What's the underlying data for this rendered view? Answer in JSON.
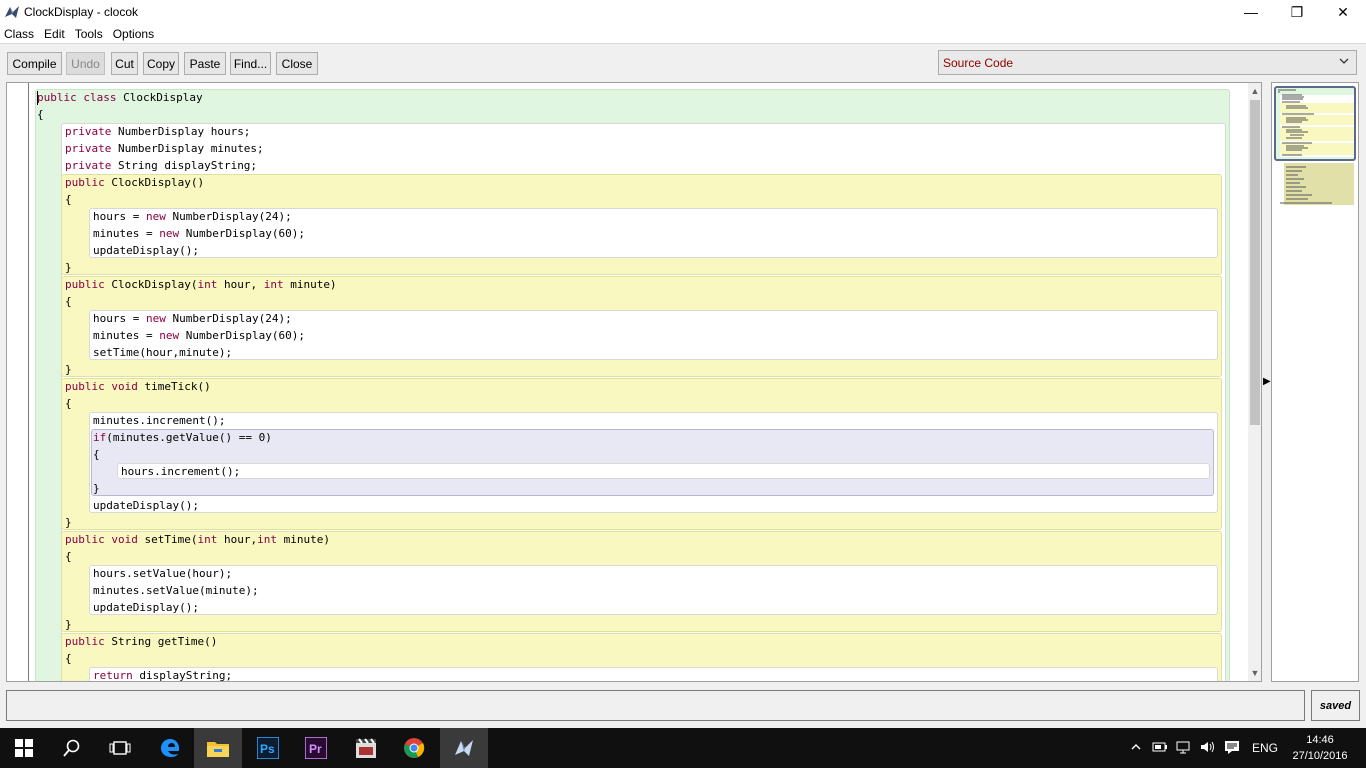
{
  "window": {
    "title": "ClockDisplay - clocok",
    "minimize_glyph": "—",
    "maximize_glyph": "❐",
    "close_glyph": "✕"
  },
  "menu": {
    "items": [
      "Class",
      "Edit",
      "Tools",
      "Options"
    ]
  },
  "toolbar": {
    "compile": "Compile",
    "undo": "Undo",
    "cut": "Cut",
    "copy": "Copy",
    "paste": "Paste",
    "find": "Find...",
    "close": "Close",
    "view_selected": "Source Code"
  },
  "editor": {
    "lines": [
      [
        {
          "t": "public class",
          "k": 1
        },
        {
          "t": " ClockDisplay"
        }
      ],
      [
        {
          "t": "{"
        }
      ],
      [
        {
          "t": "private",
          "k": 1
        },
        {
          "t": " NumberDisplay hours;"
        }
      ],
      [
        {
          "t": "private",
          "k": 1
        },
        {
          "t": " NumberDisplay minutes;"
        }
      ],
      [
        {
          "t": "private",
          "k": 1
        },
        {
          "t": " String displayString;"
        }
      ],
      [
        {
          "t": "public",
          "k": 1
        },
        {
          "t": " ClockDisplay()"
        }
      ],
      [
        {
          "t": "{"
        }
      ],
      [
        {
          "t": "hours = "
        },
        {
          "t": "new",
          "k": 1
        },
        {
          "t": " NumberDisplay(24);"
        }
      ],
      [
        {
          "t": "minutes = "
        },
        {
          "t": "new",
          "k": 1
        },
        {
          "t": " NumberDisplay(60);"
        }
      ],
      [
        {
          "t": "updateDisplay();"
        }
      ],
      [
        {
          "t": "}"
        }
      ],
      [
        {
          "t": "public",
          "k": 1
        },
        {
          "t": " ClockDisplay("
        },
        {
          "t": "int",
          "k": 1
        },
        {
          "t": " hour, "
        },
        {
          "t": "int",
          "k": 1
        },
        {
          "t": " minute)"
        }
      ],
      [
        {
          "t": "{"
        }
      ],
      [
        {
          "t": "hours = "
        },
        {
          "t": "new",
          "k": 1
        },
        {
          "t": " NumberDisplay(24);"
        }
      ],
      [
        {
          "t": "minutes = "
        },
        {
          "t": "new",
          "k": 1
        },
        {
          "t": " NumberDisplay(60);"
        }
      ],
      [
        {
          "t": "setTime(hour,minute);"
        }
      ],
      [
        {
          "t": "}"
        }
      ],
      [
        {
          "t": "public void",
          "k": 1
        },
        {
          "t": " timeTick()"
        }
      ],
      [
        {
          "t": "{"
        }
      ],
      [
        {
          "t": "minutes.increment();"
        }
      ],
      [
        {
          "t": "if",
          "k": 1
        },
        {
          "t": "(minutes.getValue() == 0)"
        }
      ],
      [
        {
          "t": "{"
        }
      ],
      [
        {
          "t": "hours.increment();"
        }
      ],
      [
        {
          "t": "}"
        }
      ],
      [
        {
          "t": "updateDisplay();"
        }
      ],
      [
        {
          "t": "}"
        }
      ],
      [
        {
          "t": "public void",
          "k": 1
        },
        {
          "t": " setTime("
        },
        {
          "t": "int",
          "k": 1
        },
        {
          "t": " hour,"
        },
        {
          "t": "int",
          "k": 1
        },
        {
          "t": " minute)"
        }
      ],
      [
        {
          "t": "{"
        }
      ],
      [
        {
          "t": "hours.setValue(hour);"
        }
      ],
      [
        {
          "t": "minutes.setValue(minute);"
        }
      ],
      [
        {
          "t": "updateDisplay();"
        }
      ],
      [
        {
          "t": "}"
        }
      ],
      [
        {
          "t": "public",
          "k": 1
        },
        {
          "t": " String getTime()"
        }
      ],
      [
        {
          "t": "{"
        }
      ],
      [
        {
          "t": "return",
          "k": 1
        },
        {
          "t": " displayString;"
        }
      ]
    ],
    "keyword_color": "#8b0044"
  },
  "status": {
    "message": "",
    "saved": "saved"
  },
  "taskbar": {
    "time": "14:46",
    "date": "27/10/2016",
    "language": "ENG",
    "apps": [
      "start-icon",
      "search-icon",
      "task-view-icon",
      "edge-icon",
      "file-explorer-icon",
      "photoshop-icon",
      "premiere-icon",
      "media-player-icon",
      "chrome-icon",
      "bluej-icon"
    ],
    "ps_label": "Ps",
    "pr_label": "Pr"
  }
}
